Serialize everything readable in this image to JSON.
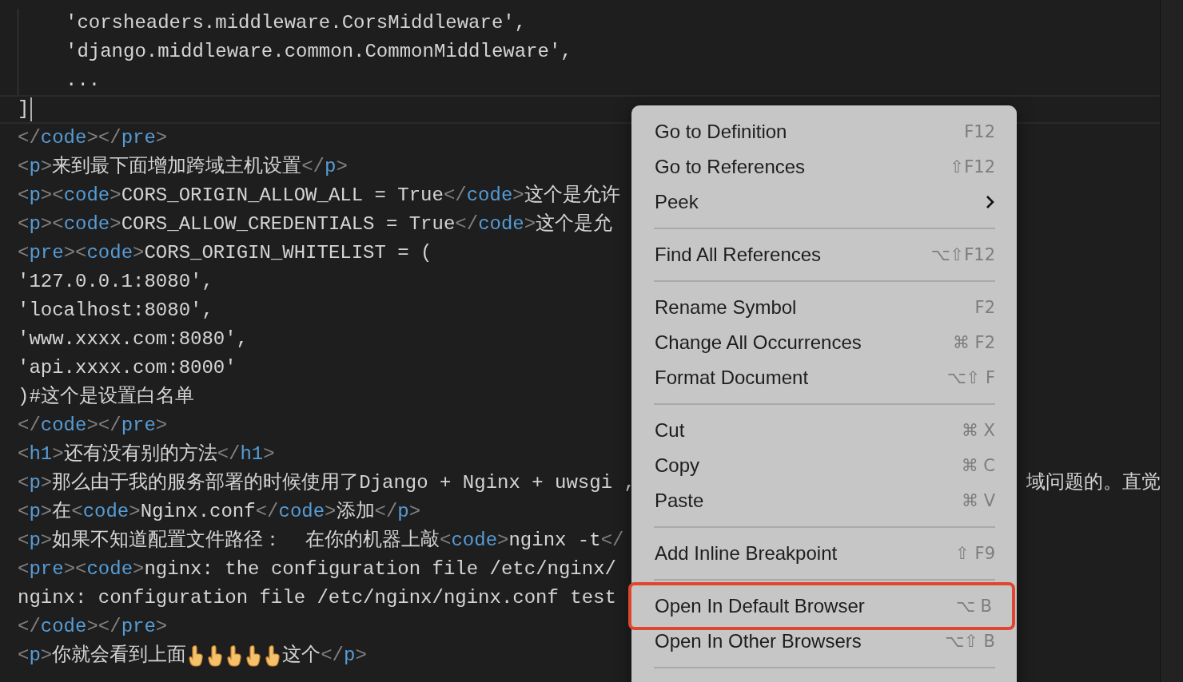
{
  "editor": {
    "lines": [
      {
        "indented": true,
        "current": false,
        "segments": [
          {
            "kind": "text",
            "text": "'corsheaders.middleware.CorsMiddleware',"
          }
        ]
      },
      {
        "indented": true,
        "current": false,
        "segments": [
          {
            "kind": "text",
            "text": "'django.middleware.common.CommonMiddleware',"
          }
        ]
      },
      {
        "indented": true,
        "current": false,
        "segments": [
          {
            "kind": "text",
            "text": "..."
          }
        ]
      },
      {
        "indented": false,
        "current": true,
        "segments": [
          {
            "kind": "text",
            "text": "]"
          }
        ]
      },
      {
        "indented": false,
        "current": false,
        "segments": [
          {
            "kind": "punct",
            "text": "</"
          },
          {
            "kind": "tag",
            "text": "code"
          },
          {
            "kind": "punct",
            "text": "></"
          },
          {
            "kind": "tag",
            "text": "pre"
          },
          {
            "kind": "punct",
            "text": ">"
          }
        ]
      },
      {
        "indented": false,
        "current": false,
        "segments": [
          {
            "kind": "punct",
            "text": "<"
          },
          {
            "kind": "tag",
            "text": "p"
          },
          {
            "kind": "punct",
            "text": ">"
          },
          {
            "kind": "text",
            "text": "来到最下面增加跨域主机设置"
          },
          {
            "kind": "punct",
            "text": "</"
          },
          {
            "kind": "tag",
            "text": "p"
          },
          {
            "kind": "punct",
            "text": ">"
          }
        ]
      },
      {
        "indented": false,
        "current": false,
        "segments": [
          {
            "kind": "punct",
            "text": "<"
          },
          {
            "kind": "tag",
            "text": "p"
          },
          {
            "kind": "punct",
            "text": "><"
          },
          {
            "kind": "tag",
            "text": "code"
          },
          {
            "kind": "punct",
            "text": ">"
          },
          {
            "kind": "text",
            "text": "CORS_ORIGIN_ALLOW_ALL = True"
          },
          {
            "kind": "punct",
            "text": "</"
          },
          {
            "kind": "tag",
            "text": "code"
          },
          {
            "kind": "punct",
            "text": ">"
          },
          {
            "kind": "text",
            "text": "这个是允许"
          }
        ]
      },
      {
        "indented": false,
        "current": false,
        "segments": [
          {
            "kind": "punct",
            "text": "<"
          },
          {
            "kind": "tag",
            "text": "p"
          },
          {
            "kind": "punct",
            "text": "><"
          },
          {
            "kind": "tag",
            "text": "code"
          },
          {
            "kind": "punct",
            "text": ">"
          },
          {
            "kind": "text",
            "text": "CORS_ALLOW_CREDENTIALS = True"
          },
          {
            "kind": "punct",
            "text": "</"
          },
          {
            "kind": "tag",
            "text": "code"
          },
          {
            "kind": "punct",
            "text": ">"
          },
          {
            "kind": "text",
            "text": "这个是允"
          }
        ]
      },
      {
        "indented": false,
        "current": false,
        "segments": [
          {
            "kind": "punct",
            "text": "<"
          },
          {
            "kind": "tag",
            "text": "pre"
          },
          {
            "kind": "punct",
            "text": "><"
          },
          {
            "kind": "tag",
            "text": "code"
          },
          {
            "kind": "punct",
            "text": ">"
          },
          {
            "kind": "text",
            "text": "CORS_ORIGIN_WHITELIST = ("
          }
        ]
      },
      {
        "indented": false,
        "current": false,
        "segments": [
          {
            "kind": "text",
            "text": "'127.0.0.1:8080',"
          }
        ]
      },
      {
        "indented": false,
        "current": false,
        "segments": [
          {
            "kind": "text",
            "text": "'localhost:8080',"
          }
        ]
      },
      {
        "indented": false,
        "current": false,
        "segments": [
          {
            "kind": "text",
            "text": "'www.xxxx.com:8080',"
          }
        ]
      },
      {
        "indented": false,
        "current": false,
        "segments": [
          {
            "kind": "text",
            "text": "'api.xxxx.com:8000'"
          }
        ]
      },
      {
        "indented": false,
        "current": false,
        "segments": [
          {
            "kind": "text",
            "text": ")#这个是设置白名单"
          }
        ]
      },
      {
        "indented": false,
        "current": false,
        "segments": [
          {
            "kind": "punct",
            "text": "</"
          },
          {
            "kind": "tag",
            "text": "code"
          },
          {
            "kind": "punct",
            "text": "></"
          },
          {
            "kind": "tag",
            "text": "pre"
          },
          {
            "kind": "punct",
            "text": ">"
          }
        ]
      },
      {
        "indented": false,
        "current": false,
        "segments": [
          {
            "kind": "punct",
            "text": "<"
          },
          {
            "kind": "tag",
            "text": "h1"
          },
          {
            "kind": "punct",
            "text": ">"
          },
          {
            "kind": "text",
            "text": "还有没有别的方法"
          },
          {
            "kind": "punct",
            "text": "</"
          },
          {
            "kind": "tag",
            "text": "h1"
          },
          {
            "kind": "punct",
            "text": ">"
          }
        ]
      },
      {
        "indented": false,
        "current": false,
        "segments": [
          {
            "kind": "punct",
            "text": "<"
          },
          {
            "kind": "tag",
            "text": "p"
          },
          {
            "kind": "punct",
            "text": ">"
          },
          {
            "kind": "text",
            "text": "那么由于我的服务部署的时候使用了Django + Nginx + uwsgi ,"
          }
        ],
        "overflow": "域问题的。直觉"
      },
      {
        "indented": false,
        "current": false,
        "segments": [
          {
            "kind": "punct",
            "text": "<"
          },
          {
            "kind": "tag",
            "text": "p"
          },
          {
            "kind": "punct",
            "text": ">"
          },
          {
            "kind": "text",
            "text": "在"
          },
          {
            "kind": "punct",
            "text": "<"
          },
          {
            "kind": "tag",
            "text": "code"
          },
          {
            "kind": "punct",
            "text": ">"
          },
          {
            "kind": "text",
            "text": "Nginx.conf"
          },
          {
            "kind": "punct",
            "text": "</"
          },
          {
            "kind": "tag",
            "text": "code"
          },
          {
            "kind": "punct",
            "text": ">"
          },
          {
            "kind": "text",
            "text": "添加"
          },
          {
            "kind": "punct",
            "text": "</"
          },
          {
            "kind": "tag",
            "text": "p"
          },
          {
            "kind": "punct",
            "text": ">"
          }
        ]
      },
      {
        "indented": false,
        "current": false,
        "segments": [
          {
            "kind": "punct",
            "text": "<"
          },
          {
            "kind": "tag",
            "text": "p"
          },
          {
            "kind": "punct",
            "text": ">"
          },
          {
            "kind": "text",
            "text": "如果不知道配置文件路径：  在你的机器上敲"
          },
          {
            "kind": "punct",
            "text": "<"
          },
          {
            "kind": "tag",
            "text": "code"
          },
          {
            "kind": "punct",
            "text": ">"
          },
          {
            "kind": "text",
            "text": "nginx -t"
          },
          {
            "kind": "punct",
            "text": "</"
          }
        ]
      },
      {
        "indented": false,
        "current": false,
        "segments": [
          {
            "kind": "punct",
            "text": "<"
          },
          {
            "kind": "tag",
            "text": "pre"
          },
          {
            "kind": "punct",
            "text": "><"
          },
          {
            "kind": "tag",
            "text": "code"
          },
          {
            "kind": "punct",
            "text": ">"
          },
          {
            "kind": "text",
            "text": "nginx: the configuration file /etc/nginx/"
          }
        ]
      },
      {
        "indented": false,
        "current": false,
        "segments": [
          {
            "kind": "text",
            "text": "nginx: configuration file /etc/nginx/nginx.conf test"
          }
        ]
      },
      {
        "indented": false,
        "current": false,
        "segments": [
          {
            "kind": "punct",
            "text": "</"
          },
          {
            "kind": "tag",
            "text": "code"
          },
          {
            "kind": "punct",
            "text": "></"
          },
          {
            "kind": "tag",
            "text": "pre"
          },
          {
            "kind": "punct",
            "text": ">"
          }
        ]
      },
      {
        "indented": false,
        "current": false,
        "segments": [
          {
            "kind": "punct",
            "text": "<"
          },
          {
            "kind": "tag",
            "text": "p"
          },
          {
            "kind": "punct",
            "text": ">"
          },
          {
            "kind": "text",
            "text": "你就会看到上面"
          },
          {
            "kind": "hand"
          },
          {
            "kind": "hand"
          },
          {
            "kind": "hand"
          },
          {
            "kind": "hand"
          },
          {
            "kind": "hand"
          },
          {
            "kind": "text",
            "text": "这个"
          },
          {
            "kind": "punct",
            "text": "</"
          },
          {
            "kind": "tag",
            "text": "p"
          },
          {
            "kind": "punct",
            "text": ">"
          }
        ]
      }
    ]
  },
  "context_menu": {
    "items": [
      {
        "kind": "item",
        "label": "Go to Definition",
        "shortcut": "F12",
        "submenu": false,
        "outlined": false
      },
      {
        "kind": "item",
        "label": "Go to References",
        "shortcut": "⇧F12",
        "submenu": false,
        "outlined": false
      },
      {
        "kind": "item",
        "label": "Peek",
        "submenu": true,
        "outlined": false
      },
      {
        "kind": "separator"
      },
      {
        "kind": "item",
        "label": "Find All References",
        "shortcut": "⌥⇧F12",
        "submenu": false,
        "outlined": false
      },
      {
        "kind": "separator"
      },
      {
        "kind": "item",
        "label": "Rename Symbol",
        "shortcut": "F2",
        "submenu": false,
        "outlined": false
      },
      {
        "kind": "item",
        "label": "Change All Occurrences",
        "shortcut": "⌘ F2",
        "submenu": false,
        "outlined": false
      },
      {
        "kind": "item",
        "label": "Format Document",
        "shortcut": "⌥⇧ F",
        "submenu": false,
        "outlined": false
      },
      {
        "kind": "separator"
      },
      {
        "kind": "item",
        "label": "Cut",
        "shortcut": "⌘ X",
        "submenu": false,
        "outlined": false
      },
      {
        "kind": "item",
        "label": "Copy",
        "shortcut": "⌘ C",
        "submenu": false,
        "outlined": false
      },
      {
        "kind": "item",
        "label": "Paste",
        "shortcut": "⌘ V",
        "submenu": false,
        "outlined": false
      },
      {
        "kind": "separator"
      },
      {
        "kind": "item",
        "label": "Add Inline Breakpoint",
        "shortcut": "⇧ F9",
        "submenu": false,
        "outlined": false
      },
      {
        "kind": "separator"
      },
      {
        "kind": "item",
        "label": "Open In Default Browser",
        "shortcut": "⌥ B",
        "submenu": false,
        "outlined": true
      },
      {
        "kind": "item",
        "label": "Open In Other Browsers",
        "shortcut": "⌥⇧ B",
        "submenu": false,
        "outlined": false
      },
      {
        "kind": "separator"
      }
    ]
  }
}
